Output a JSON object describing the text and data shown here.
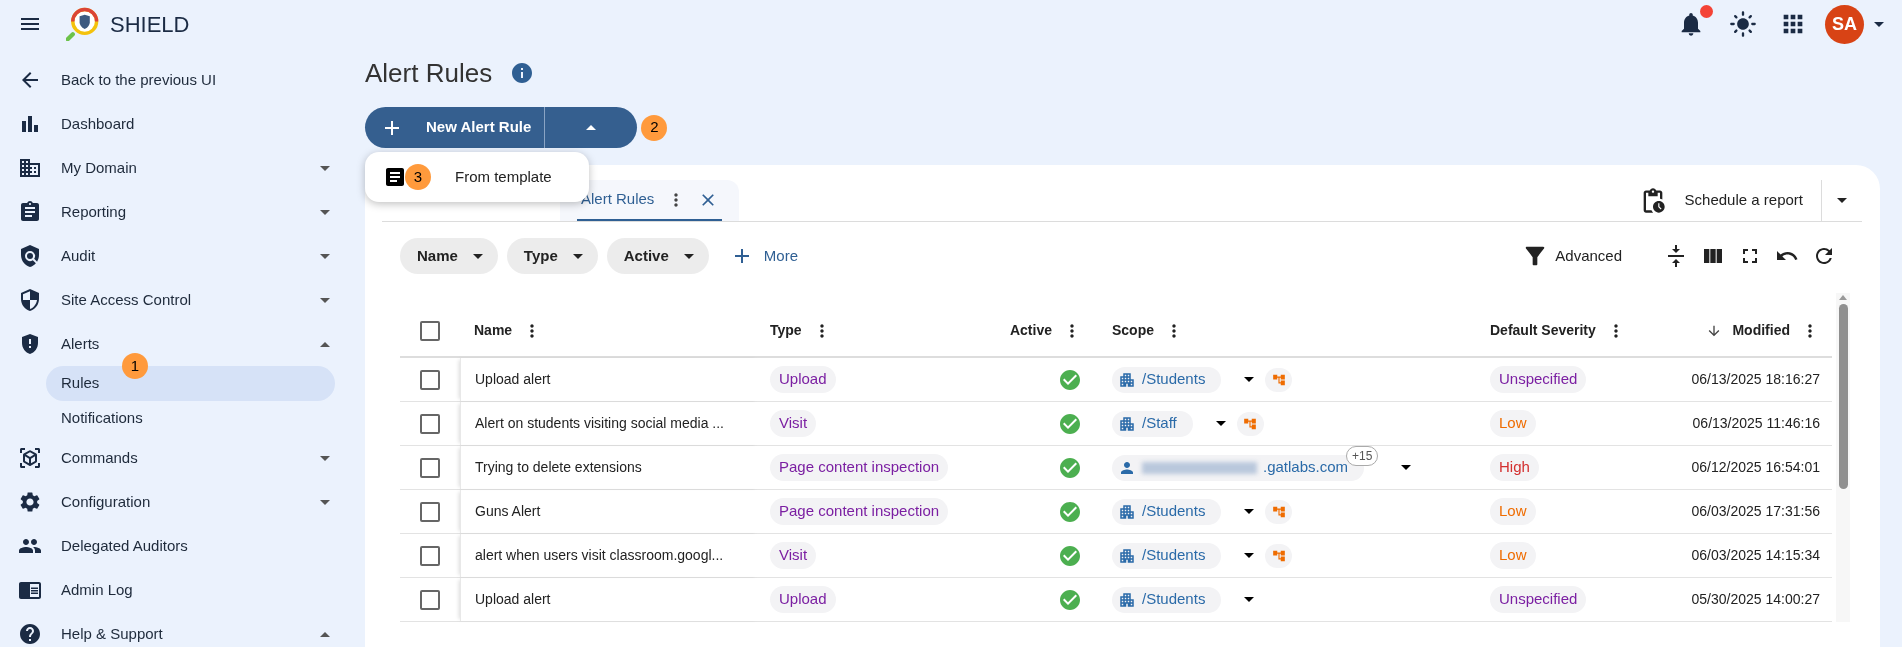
{
  "app": {
    "title": "SHIELD",
    "avatar": "SA",
    "notifications_unread": true
  },
  "sidebar": {
    "items": [
      {
        "label": "Back to the previous UI",
        "kind": "link",
        "selected": false
      },
      {
        "label": "Dashboard",
        "kind": "link",
        "selected": false
      },
      {
        "label": "My Domain",
        "kind": "group",
        "expanded": false,
        "selected": false
      },
      {
        "label": "Reporting",
        "kind": "group",
        "expanded": false,
        "selected": false
      },
      {
        "label": "Audit",
        "kind": "group",
        "expanded": false,
        "selected": false
      },
      {
        "label": "Site Access Control",
        "kind": "group",
        "expanded": false,
        "selected": false
      },
      {
        "label": "Alerts",
        "kind": "group",
        "expanded": true,
        "selected": false,
        "children": [
          {
            "label": "Rules",
            "selected": true,
            "step_marker": "1"
          },
          {
            "label": "Notifications",
            "selected": false
          }
        ]
      },
      {
        "label": "Commands",
        "kind": "group",
        "expanded": false,
        "selected": false
      },
      {
        "label": "Configuration",
        "kind": "group",
        "expanded": false,
        "selected": false
      },
      {
        "label": "Delegated Auditors",
        "kind": "link",
        "selected": false
      },
      {
        "label": "Admin Log",
        "kind": "link",
        "selected": false
      },
      {
        "label": "Help & Support",
        "kind": "group",
        "expanded": true,
        "selected": false
      }
    ]
  },
  "page": {
    "title": "Alert Rules",
    "new_button": {
      "label": "New Alert Rule",
      "step_marker": "2",
      "menu_open": true
    },
    "menu": [
      {
        "label": "From template",
        "step_marker": "3"
      }
    ]
  },
  "tabs": [
    {
      "label": "Alert Rules",
      "selected": true
    }
  ],
  "schedule_report": {
    "label": "Schedule a report"
  },
  "filters": [
    {
      "label": "Name"
    },
    {
      "label": "Type"
    },
    {
      "label": "Active"
    }
  ],
  "more_filters": "More",
  "advanced": "Advanced",
  "table": {
    "select_all_checked": false,
    "columns": [
      {
        "label": "Name",
        "sorted": false
      },
      {
        "label": "Type",
        "sorted": false
      },
      {
        "label": "Active",
        "sorted": false
      },
      {
        "label": "Scope",
        "sorted": false
      },
      {
        "label": "Default Severity",
        "sorted": false
      },
      {
        "label": "Modified",
        "sorted": true
      }
    ],
    "rows": [
      {
        "checked": false,
        "name": "Upload alert",
        "type": "Upload",
        "active": true,
        "scope": {
          "kind": "org",
          "label": "/Students",
          "inherited": true
        },
        "severity": {
          "label": "Unspecified",
          "color": "#7b1fa2"
        },
        "modified": "06/13/2025 18:16:27"
      },
      {
        "checked": false,
        "name": "Alert on students visiting social media ...",
        "type": "Visit",
        "active": true,
        "scope": {
          "kind": "org",
          "label": "/Staff",
          "inherited": true
        },
        "severity": {
          "label": "Low",
          "color": "#ef6c00"
        },
        "modified": "06/13/2025 11:46:16"
      },
      {
        "checked": false,
        "name": "Trying to delete extensions",
        "type": "Page content inspection",
        "active": true,
        "scope": {
          "kind": "user",
          "label": ".gatlabs.com",
          "extra": "+15",
          "inherited": false
        },
        "severity": {
          "label": "High",
          "color": "#d32f2f"
        },
        "modified": "06/12/2025 16:54:01"
      },
      {
        "checked": false,
        "name": "Guns Alert",
        "type": "Page content inspection",
        "active": true,
        "scope": {
          "kind": "org",
          "label": "/Students",
          "inherited": true
        },
        "severity": {
          "label": "Low",
          "color": "#ef6c00"
        },
        "modified": "06/03/2025 17:31:56"
      },
      {
        "checked": false,
        "name": "alert when users visit classroom.googl...",
        "type": "Visit",
        "active": true,
        "scope": {
          "kind": "org",
          "label": "/Students",
          "inherited": true
        },
        "severity": {
          "label": "Low",
          "color": "#ef6c00"
        },
        "modified": "06/03/2025 14:15:34"
      },
      {
        "checked": false,
        "name": "Upload alert",
        "type": "Upload",
        "active": true,
        "scope": {
          "kind": "org",
          "label": "/Students",
          "inherited": false
        },
        "severity": {
          "label": "Unspecified",
          "color": "#7b1fa2"
        },
        "modified": "05/30/2025 14:00:27"
      }
    ]
  }
}
